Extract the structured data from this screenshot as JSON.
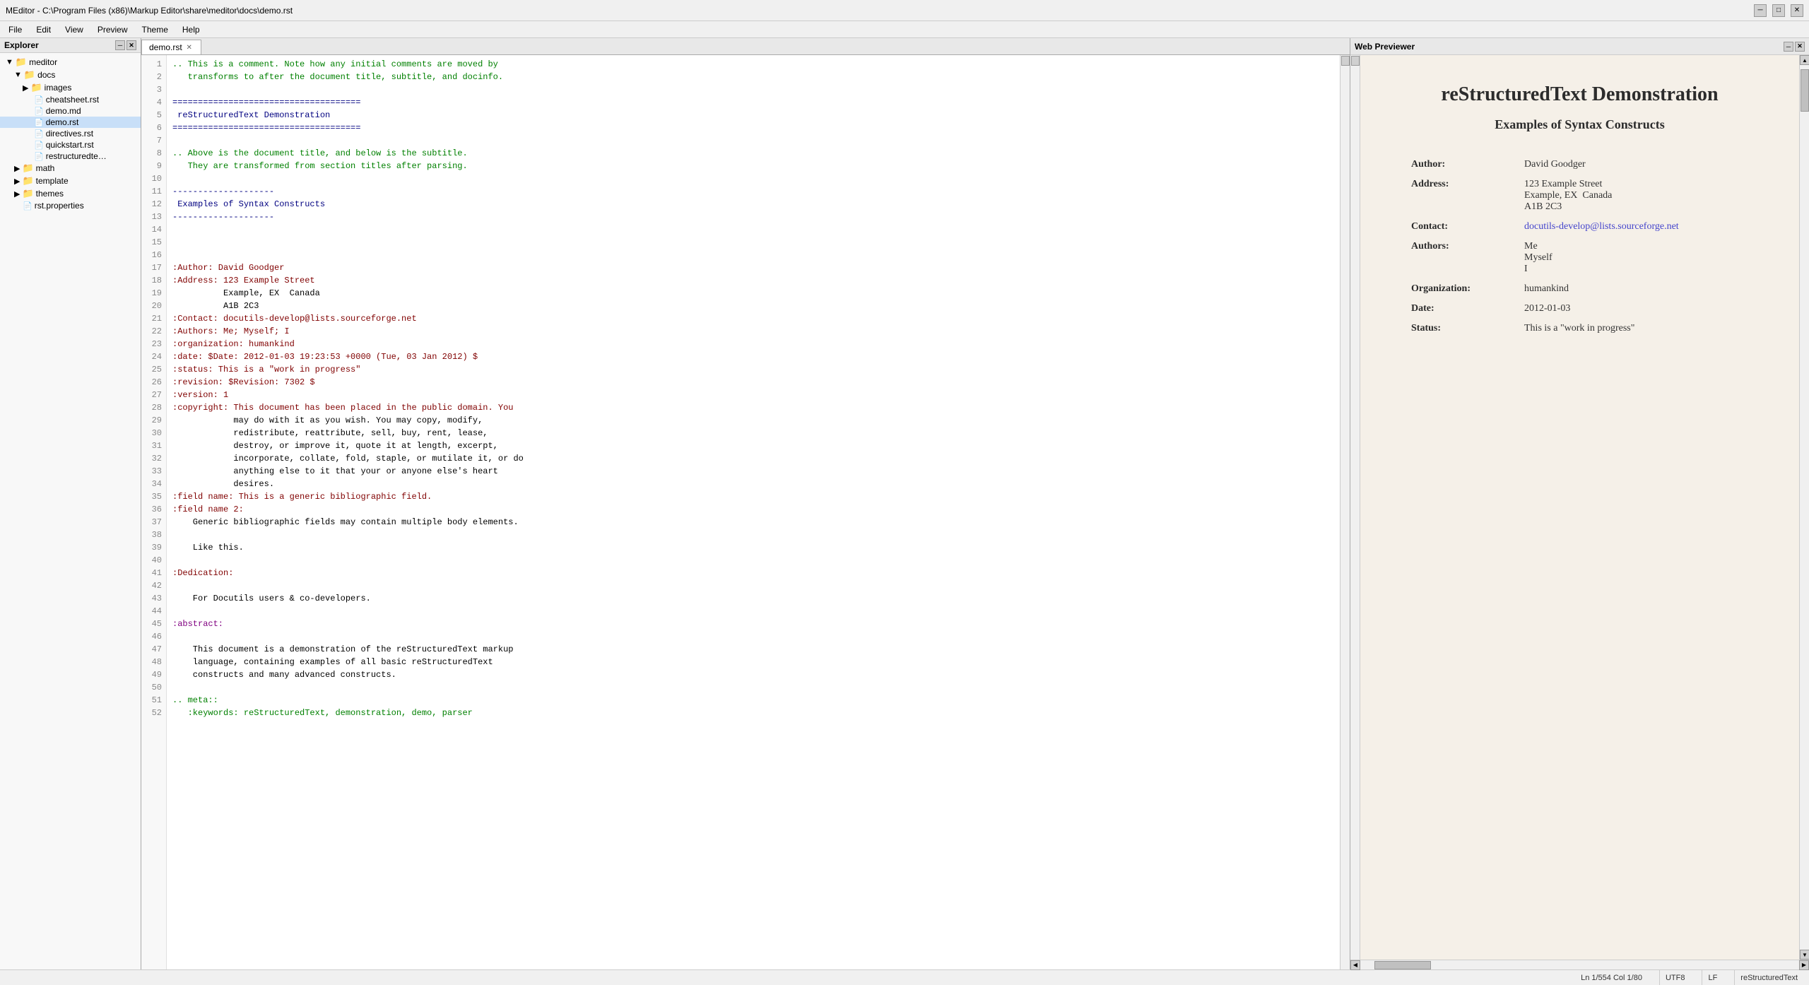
{
  "titleBar": {
    "text": "MEditor - C:\\Program Files (x86)\\Markup Editor\\share\\meditor\\docs\\demo.rst",
    "minimize": "─",
    "maximize": "□",
    "close": "✕"
  },
  "menuBar": {
    "items": [
      "File",
      "Edit",
      "View",
      "Preview",
      "Theme",
      "Help"
    ]
  },
  "explorer": {
    "title": "Explorer",
    "tree": [
      {
        "label": "meditor",
        "type": "folder-open",
        "indent": 0,
        "expanded": true
      },
      {
        "label": "docs",
        "type": "folder-open",
        "indent": 1,
        "expanded": true
      },
      {
        "label": "images",
        "type": "folder",
        "indent": 2,
        "expanded": false
      },
      {
        "label": "cheatsheet.rst",
        "type": "file-rst",
        "indent": 2
      },
      {
        "label": "demo.md",
        "type": "file-md",
        "indent": 2
      },
      {
        "label": "demo.rst",
        "type": "file-rst",
        "indent": 2,
        "selected": true
      },
      {
        "label": "directives.rst",
        "type": "file-rst",
        "indent": 2
      },
      {
        "label": "quickstart.rst",
        "type": "file-rst",
        "indent": 2
      },
      {
        "label": "restructuredte…",
        "type": "file-rst",
        "indent": 2
      },
      {
        "label": "math",
        "type": "folder",
        "indent": 1
      },
      {
        "label": "template",
        "type": "folder",
        "indent": 1
      },
      {
        "label": "themes",
        "type": "folder",
        "indent": 1
      },
      {
        "label": "rst.properties",
        "type": "file",
        "indent": 1
      }
    ]
  },
  "editor": {
    "tab": "demo.rst",
    "lines": [
      {
        "n": 1,
        "text": ".. This is a comment. Note how any initial comments are moved by",
        "class": "c-comment"
      },
      {
        "n": 2,
        "text": "   transforms to after the document title, subtitle, and docinfo.",
        "class": "c-comment"
      },
      {
        "n": 3,
        "text": ""
      },
      {
        "n": 4,
        "text": "=====================================",
        "class": "c-title-underline"
      },
      {
        "n": 5,
        "text": " reStructuredText Demonstration",
        "class": "c-title"
      },
      {
        "n": 6,
        "text": "=====================================",
        "class": "c-title-underline"
      },
      {
        "n": 7,
        "text": ""
      },
      {
        "n": 8,
        "text": ".. Above is the document title, and below is the subtitle.",
        "class": "c-comment"
      },
      {
        "n": 9,
        "text": "   They are transformed from section titles after parsing.",
        "class": "c-comment"
      },
      {
        "n": 10,
        "text": ""
      },
      {
        "n": 11,
        "text": "--------------------",
        "class": "c-title-underline"
      },
      {
        "n": 12,
        "text": " Examples of Syntax Constructs",
        "class": "c-section"
      },
      {
        "n": 13,
        "text": "--------------------",
        "class": "c-title-underline"
      },
      {
        "n": 14,
        "text": ""
      },
      {
        "n": 15,
        "text": ""
      },
      {
        "n": 16,
        "text": ""
      },
      {
        "n": 17,
        "text": ":Author: David Goodger",
        "class": "c-field"
      },
      {
        "n": 18,
        "text": ":Address: 123 Example Street",
        "class": "c-field"
      },
      {
        "n": 19,
        "text": "          Example, EX  Canada",
        "class": "c-value"
      },
      {
        "n": 20,
        "text": "          A1B 2C3",
        "class": "c-value"
      },
      {
        "n": 21,
        "text": ":Contact: docutils-develop@lists.sourceforge.net",
        "class": "c-field"
      },
      {
        "n": 22,
        "text": ":Authors: Me; Myself; I",
        "class": "c-field"
      },
      {
        "n": 23,
        "text": ":organization: humankind",
        "class": "c-field"
      },
      {
        "n": 24,
        "text": ":date: $Date: 2012-01-03 19:23:53 +0000 (Tue, 03 Jan 2012) $",
        "class": "c-field"
      },
      {
        "n": 25,
        "text": ":status: This is a \"work in progress\"",
        "class": "c-field"
      },
      {
        "n": 26,
        "text": ":revision: $Revision: 7302 $",
        "class": "c-field"
      },
      {
        "n": 27,
        "text": ":version: 1",
        "class": "c-field"
      },
      {
        "n": 28,
        "text": ":copyright: This document has been placed in the public domain. You",
        "class": "c-field"
      },
      {
        "n": 29,
        "text": "            may do with it as you wish. You may copy, modify,",
        "class": "c-value"
      },
      {
        "n": 30,
        "text": "            redistribute, reattribute, sell, buy, rent, lease,",
        "class": "c-value"
      },
      {
        "n": 31,
        "text": "            destroy, or improve it, quote it at length, excerpt,",
        "class": "c-value"
      },
      {
        "n": 32,
        "text": "            incorporate, collate, fold, staple, or mutilate it, or do",
        "class": "c-value"
      },
      {
        "n": 33,
        "text": "            anything else to it that your or anyone else's heart",
        "class": "c-value"
      },
      {
        "n": 34,
        "text": "            desires.",
        "class": "c-value"
      },
      {
        "n": 35,
        "text": ":field name: This is a generic bibliographic field.",
        "class": "c-field"
      },
      {
        "n": 36,
        "text": ":field name 2:",
        "class": "c-field"
      },
      {
        "n": 37,
        "text": "    Generic bibliographic fields may contain multiple body elements.",
        "class": "c-value"
      },
      {
        "n": 38,
        "text": ""
      },
      {
        "n": 39,
        "text": "    Like this.",
        "class": "c-value"
      },
      {
        "n": 40,
        "text": ""
      },
      {
        "n": 41,
        "text": ":Dedication:",
        "class": "c-field"
      },
      {
        "n": 42,
        "text": ""
      },
      {
        "n": 43,
        "text": "    For Docutils users & co-developers.",
        "class": "c-value"
      },
      {
        "n": 44,
        "text": ""
      },
      {
        "n": 45,
        "text": ":abstract:",
        "class": "c-directive"
      },
      {
        "n": 46,
        "text": ""
      },
      {
        "n": 47,
        "text": "    This document is a demonstration of the reStructuredText markup",
        "class": "c-value"
      },
      {
        "n": 48,
        "text": "    language, containing examples of all basic reStructuredText",
        "class": "c-value"
      },
      {
        "n": 49,
        "text": "    constructs and many advanced constructs.",
        "class": "c-value"
      },
      {
        "n": 50,
        "text": ""
      },
      {
        "n": 51,
        "text": ".. meta::",
        "class": "c-comment"
      },
      {
        "n": 52,
        "text": "   :keywords: reStructuredText, demonstration, demo, parser",
        "class": "c-comment"
      }
    ]
  },
  "preview": {
    "title": "Web Previewer",
    "documentTitle": "reStructuredText Demonstration",
    "subtitle": "Examples of Syntax Constructs",
    "metaFields": [
      {
        "label": "Author:",
        "value": "David Goodger",
        "type": "text"
      },
      {
        "label": "Address:",
        "value": "123 Example Street\nExample, EX  Canada\nA1B 2C3",
        "type": "multiline"
      },
      {
        "label": "Contact:",
        "value": "docutils-develop@lists.sourceforge.net",
        "type": "link"
      },
      {
        "label": "Authors:",
        "value": "Me\nMyself\nI",
        "type": "multiline"
      },
      {
        "label": "Organization:",
        "value": "humankind",
        "type": "text"
      },
      {
        "label": "Date:",
        "value": "2012-01-03",
        "type": "text"
      },
      {
        "label": "Status:",
        "value": "This is a \"work in progress\"",
        "type": "text"
      }
    ]
  },
  "statusBar": {
    "position": "Ln 1/554 Col 1/80",
    "encoding": "UTF8",
    "lineEnding": "LF",
    "fileType": "reStructuredText"
  },
  "icons": {
    "folderOpen": "▼📁",
    "folderClosed": "▶📁",
    "fileRst": "📄",
    "fileMd": "📄",
    "file": "📄",
    "close": "✕",
    "minimize": "─",
    "maximize": "□"
  }
}
